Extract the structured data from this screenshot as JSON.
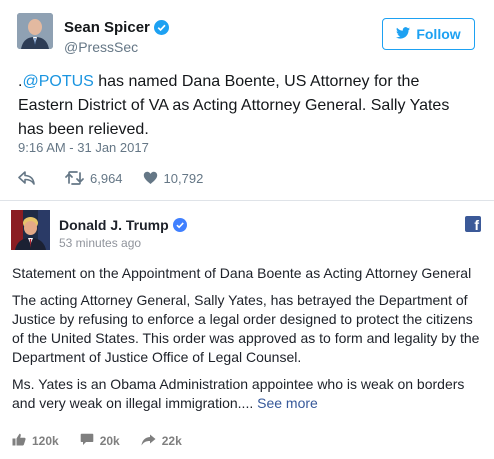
{
  "tweet": {
    "name": "Sean Spicer",
    "handle": "@PressSec",
    "follow_label": "Follow",
    "text_prefix": ".",
    "mention": "@POTUS",
    "text_body": " has named Dana Boente, US Attorney for the Eastern District of VA as Acting Attorney General. Sally Yates has been relieved.",
    "timestamp": "9:16 AM - 31 Jan 2017",
    "retweets": "6,964",
    "likes": "10,792",
    "accent_color": "#1da1f2"
  },
  "facebook_post": {
    "name": "Donald J. Trump",
    "time": "53 minutes ago",
    "paragraphs": [
      "Statement on the Appointment of Dana Boente as Acting Attorney General",
      "The acting Attorney General, Sally Yates, has betrayed the Department of Justice by refusing to enforce a legal order designed to protect the citizens of the United States. This order was approved as to form and legality by the Department of Justice Office of Legal Counsel."
    ],
    "last_paragraph": "Ms. Yates is an Obama Administration appointee who is weak on borders and very weak on illegal immigration.... ",
    "see_more": "See more",
    "likes": "120k",
    "comments": "20k",
    "shares": "22k",
    "brand_color": "#3b5998"
  }
}
